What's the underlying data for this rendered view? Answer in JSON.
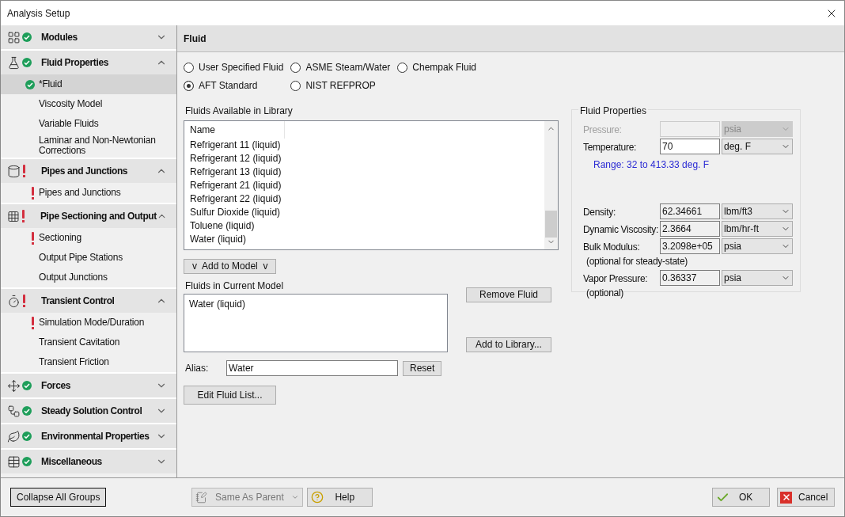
{
  "window": {
    "title": "Analysis Setup"
  },
  "sidebar": {
    "groups": [
      {
        "label": "Modules",
        "complete": true,
        "error": false,
        "expanded": false
      },
      {
        "label": "Fluid Properties",
        "complete": true,
        "error": false,
        "expanded": true,
        "items": [
          {
            "label": "*Fluid",
            "complete": true,
            "error": false,
            "selected": true
          },
          {
            "label": "Viscosity Model",
            "complete": false,
            "error": false,
            "selected": false
          },
          {
            "label": "Variable Fluids",
            "complete": false,
            "error": false,
            "selected": false
          },
          {
            "label": "Laminar and Non-Newtonian Corrections",
            "complete": false,
            "error": false,
            "selected": false
          }
        ]
      },
      {
        "label": "Pipes and Junctions",
        "complete": false,
        "error": true,
        "expanded": true,
        "items": [
          {
            "label": "Pipes and Junctions",
            "complete": false,
            "error": true,
            "selected": false
          }
        ]
      },
      {
        "label": "Pipe Sectioning and Output",
        "complete": false,
        "error": true,
        "expanded": true,
        "items": [
          {
            "label": "Sectioning",
            "complete": false,
            "error": true,
            "selected": false
          },
          {
            "label": "Output Pipe Stations",
            "complete": false,
            "error": false,
            "selected": false
          },
          {
            "label": "Output Junctions",
            "complete": false,
            "error": false,
            "selected": false
          }
        ]
      },
      {
        "label": "Transient Control",
        "complete": false,
        "error": true,
        "expanded": true,
        "items": [
          {
            "label": "Simulation Mode/Duration",
            "complete": false,
            "error": true,
            "selected": false
          },
          {
            "label": "Transient Cavitation",
            "complete": false,
            "error": false,
            "selected": false
          },
          {
            "label": "Transient Friction",
            "complete": false,
            "error": false,
            "selected": false
          }
        ]
      },
      {
        "label": "Forces",
        "complete": true,
        "error": false,
        "expanded": false
      },
      {
        "label": "Steady Solution Control",
        "complete": true,
        "error": false,
        "expanded": false
      },
      {
        "label": "Environmental Properties",
        "complete": true,
        "error": false,
        "expanded": false
      },
      {
        "label": "Miscellaneous",
        "complete": true,
        "error": false,
        "expanded": false
      }
    ]
  },
  "panel": {
    "title": "Fluid",
    "sources": [
      {
        "label": "User Specified Fluid",
        "selected": false
      },
      {
        "label": "ASME Steam/Water",
        "selected": false
      },
      {
        "label": "Chempak Fluid",
        "selected": false
      },
      {
        "label": "AFT Standard",
        "selected": true
      },
      {
        "label": "NIST REFPROP",
        "selected": false
      }
    ],
    "library": {
      "label": "Fluids Available in Library",
      "column": "Name",
      "rows": [
        "Refrigerant 11 (liquid)",
        "Refrigerant 12 (liquid)",
        "Refrigerant 13 (liquid)",
        "Refrigerant 21 (liquid)",
        "Refrigerant 22 (liquid)",
        "Sulfur Dioxide (liquid)",
        "Toluene (liquid)",
        "Water (liquid)"
      ]
    },
    "add_button": "v  Add to Model  v",
    "current": {
      "label": "Fluids in Current Model",
      "rows": [
        "Water (liquid)"
      ]
    },
    "remove_button": "Remove Fluid",
    "add_library_button": "Add to Library...",
    "alias": {
      "label": "Alias:",
      "value": "Water"
    },
    "reset_button": "Reset",
    "edit_button": "Edit Fluid List...",
    "properties": {
      "title": "Fluid Properties",
      "range": "Range: 32 to 413.33 deg. F",
      "rows": [
        {
          "label": "Pressure:",
          "value": "",
          "unit": "psia",
          "disabled": true
        },
        {
          "label": "Temperature:",
          "value": "70",
          "unit": "deg. F",
          "disabled": false,
          "editable": true
        },
        {
          "label": "Density:",
          "value": "62.34661",
          "unit": "lbm/ft3",
          "disabled": false,
          "editable": false
        },
        {
          "label": "Dynamic Viscosity:",
          "value": "2.3664",
          "unit": "lbm/hr-ft",
          "disabled": false,
          "editable": false
        },
        {
          "label": "Bulk Modulus:",
          "note": "(optional for steady-state)",
          "value": "3.2098e+05",
          "unit": "psia",
          "disabled": false,
          "editable": false
        },
        {
          "label": "Vapor Pressure:",
          "note": "(optional)",
          "value": "0.36337",
          "unit": "psia",
          "disabled": false,
          "editable": false
        }
      ]
    }
  },
  "footer": {
    "collapse": "Collapse All Groups",
    "parent": {
      "label": "Same As Parent",
      "disabled": true
    },
    "help": "Help",
    "ok": "OK",
    "cancel": "Cancel"
  }
}
